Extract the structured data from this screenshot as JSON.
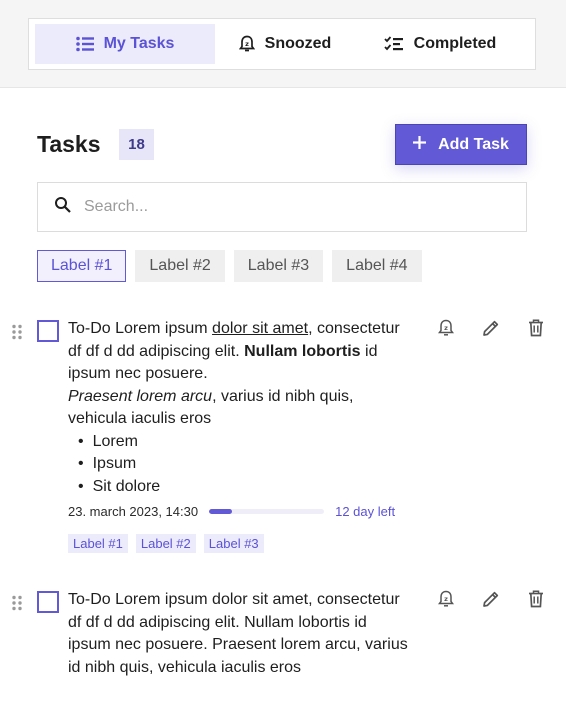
{
  "tabs": [
    {
      "label": "My Tasks",
      "icon": "list-icon",
      "active": true
    },
    {
      "label": "Snoozed",
      "icon": "alarm-icon",
      "active": false
    },
    {
      "label": "Completed",
      "icon": "checklist-icon",
      "active": false
    }
  ],
  "header": {
    "title": "Tasks",
    "count": "18",
    "add_label": "Add Task"
  },
  "search": {
    "placeholder": "Search..."
  },
  "filter_labels": [
    {
      "label": "Label #1",
      "selected": true
    },
    {
      "label": "Label #2",
      "selected": false
    },
    {
      "label": "Label #3",
      "selected": false
    },
    {
      "label": "Label #4",
      "selected": false
    }
  ],
  "tasks": [
    {
      "text_parts": {
        "p1": "To-Do Lorem ipsum ",
        "p1_underline": "dolor sit amet",
        "p1_rest": ", consectetur df df d dd adipiscing elit.",
        "p2_bold": "Nullam lobortis",
        "p2_rest": " id ipsum nec posuere.",
        "p3_italic": "Praesent lorem arcu",
        "p3_rest": ", varius id nibh quis, vehicula iaculis eros"
      },
      "bullets": [
        "Lorem",
        "Ipsum",
        "Sit dolore"
      ],
      "due_date": "23. march 2023, 14:30",
      "progress": 0.2,
      "days_left": "12 day left",
      "labels": [
        "Label #1",
        "Label #2",
        "Label #3"
      ]
    },
    {
      "text": "To-Do Lorem ipsum dolor sit amet, consectetur df df d dd adipiscing elit. Nullam lobortis id ipsum nec posuere. Praesent lorem arcu, varius id nibh quis, vehicula iaculis eros"
    }
  ],
  "colors": {
    "accent": "#6159d6",
    "accent_light": "#ecebfb"
  }
}
